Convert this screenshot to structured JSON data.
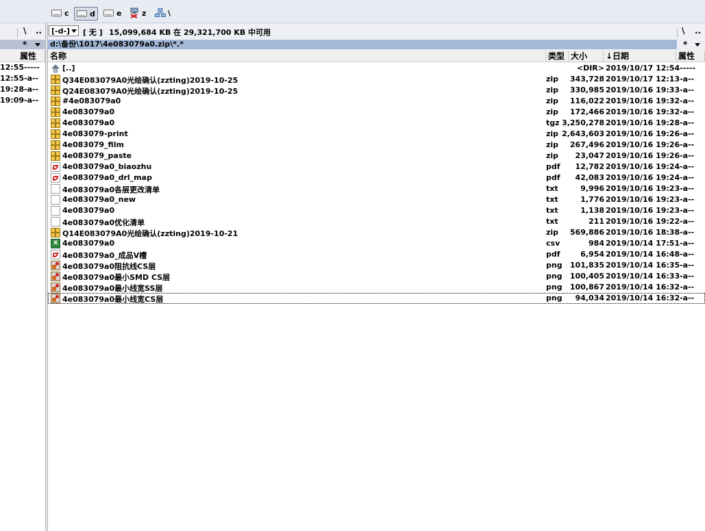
{
  "drives": [
    {
      "label": "c",
      "icon": "drive-icon"
    },
    {
      "label": "d",
      "icon": "drive-icon",
      "active": true
    },
    {
      "label": "e",
      "icon": "drive-icon"
    },
    {
      "label": "z",
      "icon": "network-drive-disconnected-icon"
    },
    {
      "label": "\\",
      "icon": "network-icon"
    }
  ],
  "left_panel": {
    "nav_root": "\\",
    "nav_up": "..",
    "filter": "*",
    "attr_header": "属性",
    "rows": [
      "12:55-----",
      "12:55-a--",
      "19:28-a--",
      "19:09-a--"
    ]
  },
  "right_panel": {
    "drive_combo": "[-d-]",
    "volume_label": "[ 无 ]",
    "free_space": "15,099,684 KB 在 29,321,700 KB 中可用",
    "nav_root": "\\",
    "nav_up": "..",
    "filter": "*",
    "path": "d:\\备份\\1017\\4e083079a0.zip\\*.*",
    "headers": {
      "name": "名称",
      "ext": "类型",
      "size": "大小",
      "date": "↓日期",
      "attr": "属性"
    },
    "files": [
      {
        "name": "[..]",
        "ext": "",
        "size": "<DIR>",
        "date": "2019/10/17 12:54-----",
        "icon": "up-dir-icon"
      },
      {
        "name": "Q34E083079A0光绘确认(zzting)2019-10-25",
        "ext": "zip",
        "size": "343,728",
        "date": "2019/10/17 12:13-a--",
        "icon": "zip-icon"
      },
      {
        "name": "Q24E083079A0光绘确认(zzting)2019-10-25",
        "ext": "zip",
        "size": "330,985",
        "date": "2019/10/16 19:33-a--",
        "icon": "zip-icon"
      },
      {
        "name": "#4e083079a0",
        "ext": "zip",
        "size": "116,022",
        "date": "2019/10/16 19:32-a--",
        "icon": "zip-icon"
      },
      {
        "name": "4e083079a0",
        "ext": "zip",
        "size": "172,466",
        "date": "2019/10/16 19:32-a--",
        "icon": "zip-icon"
      },
      {
        "name": "4e083079a0",
        "ext": "tgz",
        "size": "3,250,278",
        "date": "2019/10/16 19:28-a--",
        "icon": "zip-icon"
      },
      {
        "name": "4e083079-print",
        "ext": "zip",
        "size": "2,643,603",
        "date": "2019/10/16 19:26-a--",
        "icon": "zip-icon"
      },
      {
        "name": "4e083079_film",
        "ext": "zip",
        "size": "267,496",
        "date": "2019/10/16 19:26-a--",
        "icon": "zip-icon"
      },
      {
        "name": "4e083079_paste",
        "ext": "zip",
        "size": "23,047",
        "date": "2019/10/16 19:26-a--",
        "icon": "zip-icon"
      },
      {
        "name": "4e083079a0_biaozhu",
        "ext": "pdf",
        "size": "12,782",
        "date": "2019/10/16 19:24-a--",
        "icon": "pdf-icon"
      },
      {
        "name": "4e083079a0_drl_map",
        "ext": "pdf",
        "size": "42,083",
        "date": "2019/10/16 19:24-a--",
        "icon": "pdf-icon"
      },
      {
        "name": "4e083079a0各层更改清单",
        "ext": "txt",
        "size": "9,996",
        "date": "2019/10/16 19:23-a--",
        "icon": "txt-icon"
      },
      {
        "name": "4e083079a0_new",
        "ext": "txt",
        "size": "1,776",
        "date": "2019/10/16 19:23-a--",
        "icon": "txt-icon"
      },
      {
        "name": "4e083079a0",
        "ext": "txt",
        "size": "1,138",
        "date": "2019/10/16 19:23-a--",
        "icon": "txt-icon"
      },
      {
        "name": "4e083079a0优化清单",
        "ext": "txt",
        "size": "211",
        "date": "2019/10/16 19:22-a--",
        "icon": "txt-icon"
      },
      {
        "name": "Q14E083079A0光绘确认(zzting)2019-10-21",
        "ext": "zip",
        "size": "569,886",
        "date": "2019/10/16 18:38-a--",
        "icon": "zip-icon"
      },
      {
        "name": "4e083079a0",
        "ext": "csv",
        "size": "984",
        "date": "2019/10/14 17:51-a--",
        "icon": "csv-icon"
      },
      {
        "name": "4e083079a0_成品V槽",
        "ext": "pdf",
        "size": "6,954",
        "date": "2019/10/14 16:48-a--",
        "icon": "pdf-icon"
      },
      {
        "name": "4e083079a0阻抗线CS层",
        "ext": "png",
        "size": "101,835",
        "date": "2019/10/14 16:35-a--",
        "icon": "png-icon"
      },
      {
        "name": "4e083079a0最小SMD CS层",
        "ext": "png",
        "size": "100,405",
        "date": "2019/10/14 16:33-a--",
        "icon": "png-icon"
      },
      {
        "name": "4e083079a0最小线宽SS层",
        "ext": "png",
        "size": "100,867",
        "date": "2019/10/14 16:32-a--",
        "icon": "png-icon"
      },
      {
        "name": "4e083079a0最小线宽CS层",
        "ext": "png",
        "size": "94,034",
        "date": "2019/10/14 16:32-a--",
        "icon": "png-icon",
        "focused": true
      }
    ]
  }
}
